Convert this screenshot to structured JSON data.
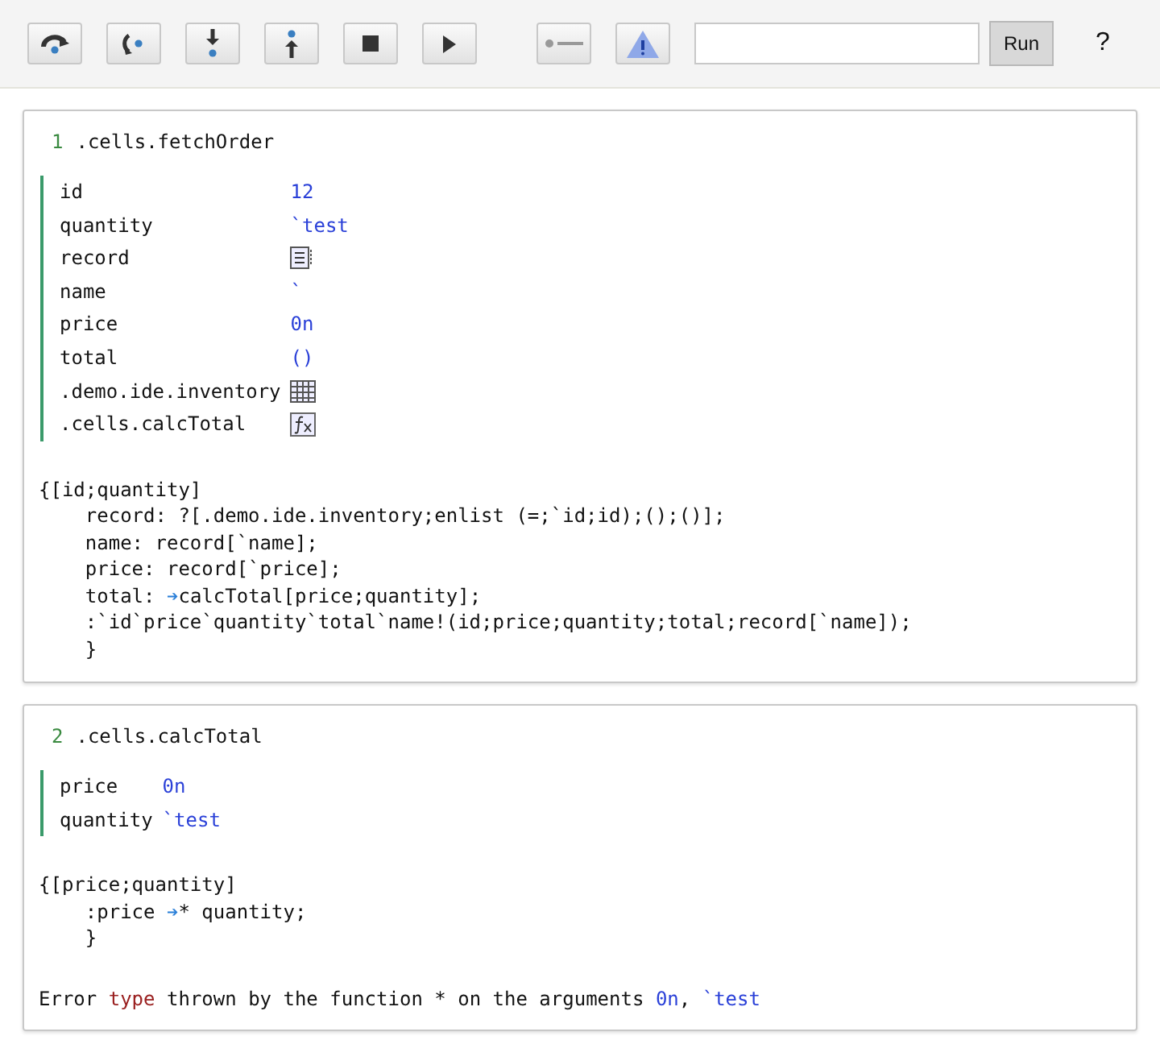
{
  "toolbar": {
    "buttons": [
      {
        "kind": "step-over"
      },
      {
        "kind": "step-back"
      },
      {
        "kind": "step-in"
      },
      {
        "kind": "step-out"
      },
      {
        "kind": "stop"
      },
      {
        "kind": "play"
      },
      {
        "kind": "breakpoint"
      },
      {
        "kind": "warning"
      }
    ],
    "run_button": "Run",
    "help": "?"
  },
  "cells": [
    {
      "number": "1",
      "name": ".cells.fetchOrder",
      "variables": [
        {
          "name": "id",
          "kind": "text",
          "value": "12"
        },
        {
          "name": "quantity",
          "kind": "text",
          "value": "`test"
        },
        {
          "name": "record",
          "kind": "dictionary"
        },
        {
          "name": "name",
          "kind": "text",
          "value": "`"
        },
        {
          "name": "price",
          "kind": "text",
          "value": "0n"
        },
        {
          "name": "total",
          "kind": "text",
          "value": "()"
        },
        {
          "name": ".demo.ide.inventory",
          "kind": "table"
        },
        {
          "name": ".cells.calcTotal",
          "kind": "function"
        }
      ],
      "code": [
        [
          {
            "kind": "plain",
            "text": "{[id;quantity]"
          }
        ],
        [
          {
            "kind": "plain",
            "text": "    record: ?[.demo.ide.inventory;enlist (=;`id;id);();()];"
          }
        ],
        [
          {
            "kind": "plain",
            "text": "    name: record[`name];"
          }
        ],
        [
          {
            "kind": "plain",
            "text": "    price: record[`price];"
          }
        ],
        [
          {
            "kind": "plain",
            "text": "    total: "
          },
          {
            "kind": "marker",
            "text": "➔"
          },
          {
            "kind": "plain",
            "text": "calcTotal[price;quantity];"
          }
        ],
        [
          {
            "kind": "plain",
            "text": "    :`id`price`quantity`total`name!(id;price;quantity;total;record[`name]);"
          }
        ],
        [
          {
            "kind": "plain",
            "text": "    }"
          }
        ]
      ]
    },
    {
      "number": "2",
      "name": ".cells.calcTotal",
      "variables": [
        {
          "name": "price",
          "kind": "text",
          "value": "0n"
        },
        {
          "name": "quantity",
          "kind": "text",
          "value": "`test"
        }
      ],
      "code": [
        [
          {
            "kind": "plain",
            "text": "{[price;quantity]"
          }
        ],
        [
          {
            "kind": "plain",
            "text": "    :price "
          },
          {
            "kind": "marker",
            "text": "➔"
          },
          {
            "kind": "plain",
            "text": "* quantity;"
          }
        ],
        [
          {
            "kind": "plain",
            "text": "    }"
          }
        ]
      ],
      "error": [
        {
          "kind": "plain",
          "text": "Error "
        },
        {
          "kind": "keyword",
          "text": "type"
        },
        {
          "kind": "plain",
          "text": " thrown by the function * on the arguments "
        },
        {
          "kind": "value",
          "text": "0n"
        },
        {
          "kind": "plain",
          "text": ", "
        },
        {
          "kind": "value",
          "text": "`test"
        }
      ]
    }
  ]
}
